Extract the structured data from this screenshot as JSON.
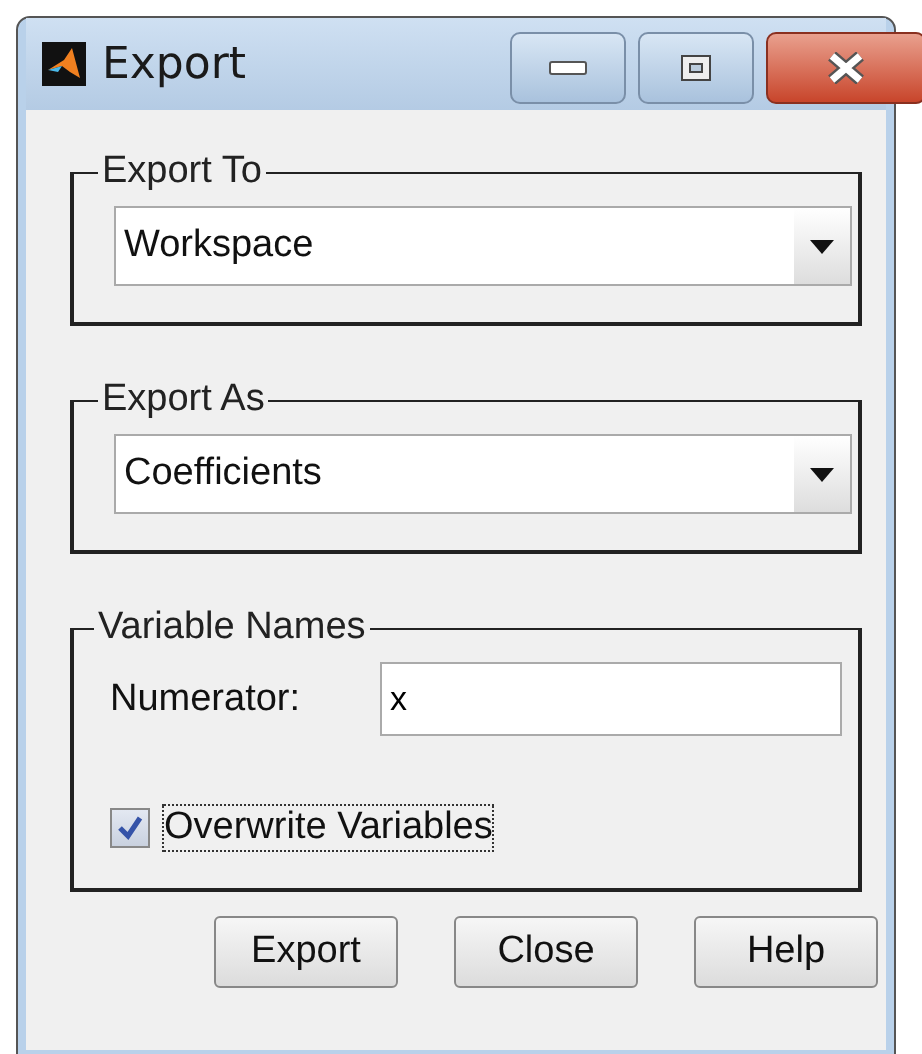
{
  "window": {
    "title": "Export"
  },
  "groups": [
    {
      "kind": "dropdown",
      "legend": "Export To",
      "value": "Workspace"
    },
    {
      "kind": "dropdown",
      "legend": "Export As",
      "value": "Coefficients"
    },
    {
      "kind": "variables",
      "legend": "Variable Names",
      "fields": [
        {
          "label": "Numerator:",
          "value": "x"
        }
      ],
      "checkbox": {
        "label": "Overwrite Variables",
        "checked": true,
        "focused": true
      }
    }
  ],
  "buttons": [
    "Export",
    "Close",
    "Help"
  ]
}
